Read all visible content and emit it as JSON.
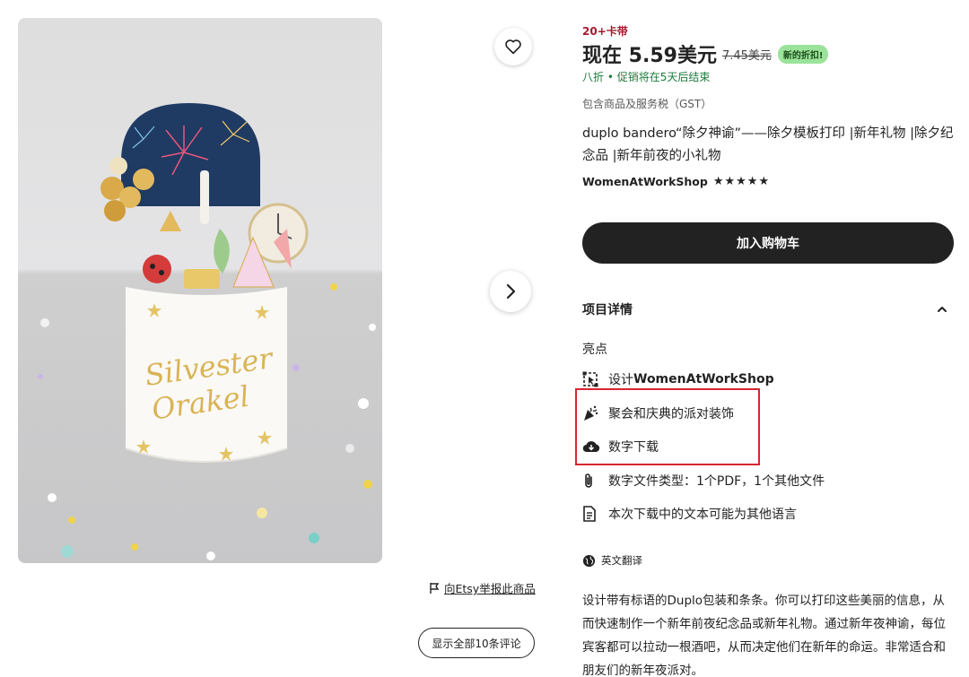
{
  "product": {
    "stock_label": "20+卡带",
    "price_now": "现在 5.59美元",
    "price_old": "7.45美元",
    "sale_badge": "新的折扣!",
    "discount_text": "八折 • 促销将在5天后结束",
    "tax_note": "包含商品及服务税（GST）",
    "title": "duplo bandero“除夕神谕”——除夕模板打印 |新年礼物 |除夕纪念品 |新年前夜的小礼物",
    "shop_name": "WomenAtWorkShop",
    "rating_stars": "★★★★★",
    "add_to_cart_label": "加入购物车"
  },
  "details": {
    "section_title": "项目详情",
    "highlights_label": "亮点",
    "designer_prefix": "设计",
    "designer_name": "WomenAtWorkShop",
    "party_item": "聚会和庆典的派对装饰",
    "download_item": "数字下载",
    "file_types": "数字文件类型：1个PDF，1个其他文件",
    "language_note": "本次下载中的文本可能为其他语言",
    "translate_label": "英文翻译",
    "description": "设计带有标语的Duplo包装和条条。你可以打印这些美丽的信息，从而快速制作一个新年前夜纪念品或新年礼物。通过新年夜神谕，每位宾客都可以拉动一根酒吧，从而决定他们在新年的命运。非常适合和朋友们的新年夜派对。"
  },
  "gallery": {
    "image_text": "Silvester Orakel",
    "report_link": "向Etsy举报此商品",
    "reviews_button": "显示全部10条评论"
  },
  "icons": {
    "favorite": "heart-icon",
    "next": "chevron-right-icon",
    "collapse": "chevron-up-icon",
    "report": "flag-icon",
    "designer": "design-tool-icon",
    "party": "party-popper-icon",
    "download": "cloud-download-icon",
    "file_types": "paperclip-icon",
    "language": "document-icon",
    "translate": "globe-icon"
  },
  "colors": {
    "stock": "#a61a2e",
    "discount": "#1e7b3b",
    "badge_bg": "#9be39a",
    "cart_button": "#222222",
    "annotation_box": "#d8262f"
  }
}
